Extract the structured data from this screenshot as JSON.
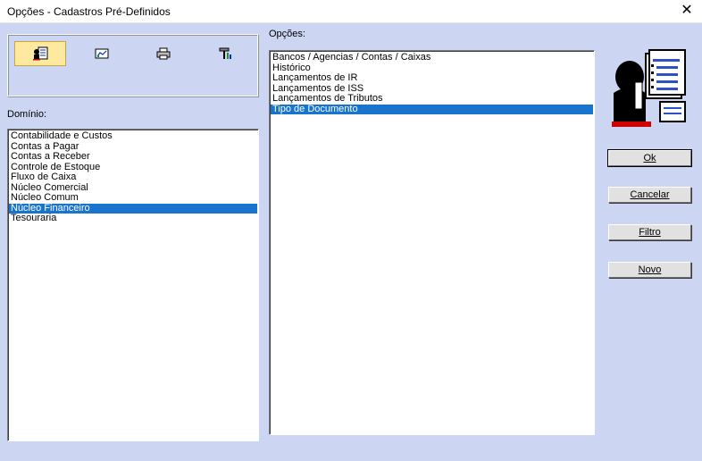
{
  "window": {
    "title": "Opções - Cadastros Pré-Definidos",
    "close_glyph": "✕"
  },
  "toolbar": {
    "buttons": [
      {
        "icon": "user-document-icon",
        "active": true
      },
      {
        "icon": "chart-icon",
        "active": false
      },
      {
        "icon": "printer-icon",
        "active": false
      },
      {
        "icon": "tools-icon",
        "active": false
      }
    ]
  },
  "dominio": {
    "label": "Domínio:",
    "items": [
      "Contabilidade e Custos",
      "Contas a Pagar",
      "Contas a Receber",
      "Controle de Estoque",
      "Fluxo de Caixa",
      "Núcleo Comercial",
      "Núcleo Comum",
      "Núcleo Financeiro",
      "Tesouraria"
    ],
    "selected_index": 7
  },
  "opcoes": {
    "label": "Opções:",
    "items": [
      "Bancos / Agencias / Contas / Caixas",
      "Histórico",
      "Lançamentos de IR",
      "Lançamentos de ISS",
      "Lançamentos de Tributos",
      "Tipo de Documento"
    ],
    "selected_index": 5
  },
  "buttons": {
    "ok": "Ok",
    "cancelar": "Cancelar",
    "filtro": "Filtro",
    "novo": "Novo"
  },
  "colors": {
    "background": "#ccd5f2",
    "selection": "#1874cd",
    "active_tool": "#fde9a0"
  }
}
